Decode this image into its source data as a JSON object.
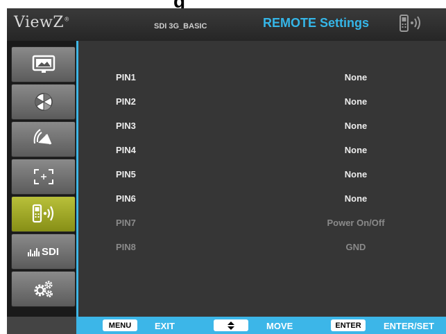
{
  "page_heading": "g",
  "header": {
    "brand": "ViewZ",
    "brand_mark": "®",
    "model": "SDI 3G_BASIC",
    "menu_title": "REMOTE Settings",
    "icon": "remote-phone-icon"
  },
  "sidebar": {
    "items": [
      {
        "name": "picture",
        "icon": "picture-icon",
        "active": false
      },
      {
        "name": "color",
        "icon": "color-wheel-icon",
        "active": false
      },
      {
        "name": "audio",
        "icon": "speaker-icon",
        "active": false
      },
      {
        "name": "marker",
        "icon": "marker-crosshair-icon",
        "active": false
      },
      {
        "name": "remote",
        "icon": "remote-phone-icon",
        "active": true
      },
      {
        "name": "sdi",
        "label": "SDI",
        "icon": "sdi-bars-icon",
        "active": false
      },
      {
        "name": "setup",
        "icon": "gears-icon",
        "active": false
      }
    ]
  },
  "rows": [
    {
      "label": "PIN1",
      "value": "None",
      "enabled": true
    },
    {
      "label": "PIN2",
      "value": "None",
      "enabled": true
    },
    {
      "label": "PIN3",
      "value": "None",
      "enabled": true
    },
    {
      "label": "PIN4",
      "value": "None",
      "enabled": true
    },
    {
      "label": "PIN5",
      "value": "None",
      "enabled": true
    },
    {
      "label": "PIN6",
      "value": "None",
      "enabled": true
    },
    {
      "label": "PIN7",
      "value": "Power On/Off",
      "enabled": false
    },
    {
      "label": "PIN8",
      "value": "GND",
      "enabled": false
    }
  ],
  "footer": {
    "menu_key": "MENU",
    "menu_action": "EXIT",
    "move_key_icon": "up-down-arrow-icon",
    "move_action": "MOVE",
    "enter_key": "ENTER",
    "enter_action": "ENTER/SET"
  },
  "colors": {
    "accent": "#3cb6e8",
    "active_tab": "#a6ad2b",
    "panel": "#363636"
  }
}
